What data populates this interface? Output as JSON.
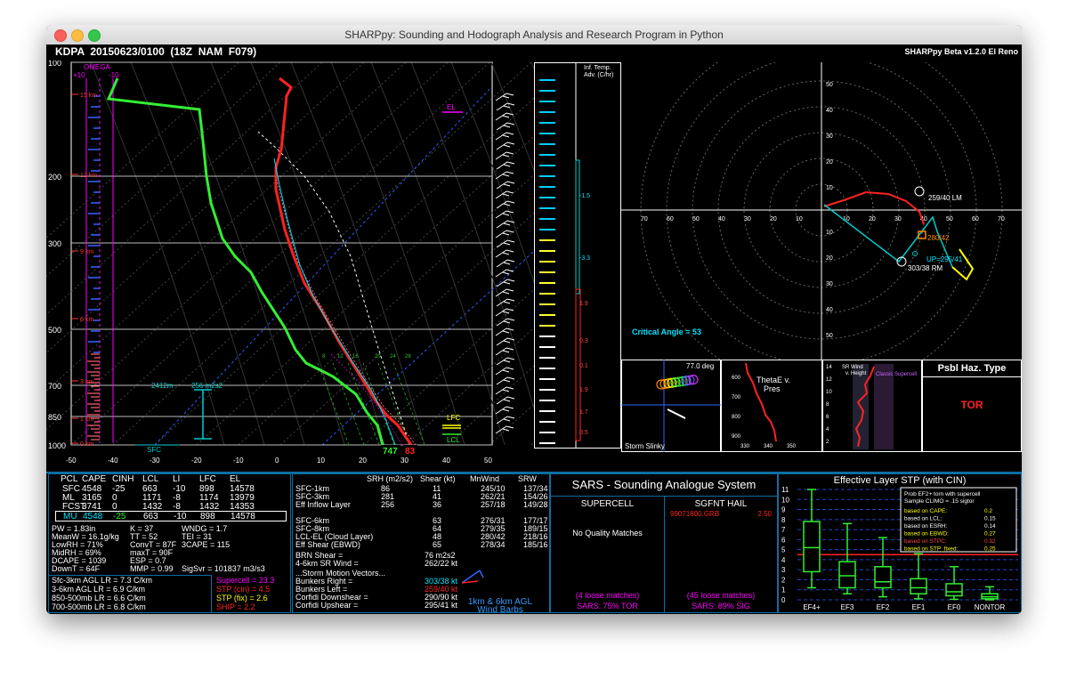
{
  "window": {
    "title": "SHARPpy: Sounding and Hodograph Analysis and Research Program in Python",
    "station_label": "KDPA  20150623/0100  (18Z  NAM  F079)",
    "version_label": "SHARPpy Beta v1.2.0 El Reno"
  },
  "skewt": {
    "pressure_levels": [
      "100",
      "200",
      "300",
      "500",
      "700",
      "850",
      "1000"
    ],
    "temp_ticks": [
      "-50",
      "-40",
      "-30",
      "-20",
      "-10",
      "0",
      "10",
      "20",
      "30",
      "40",
      "50"
    ],
    "height_marks": [
      "15 km",
      "12 km",
      "9 km",
      "6 km",
      "3 km",
      "1 km",
      "0 km"
    ],
    "omega_label": "OMEGA",
    "omega_ticks": [
      "+10",
      "-10"
    ],
    "el_label": "EL",
    "lfc_label": "LFC",
    "lcl_label": "LCL",
    "sfc_label": "SFC",
    "inflow_top": "2412m",
    "inflow_srh": "256 m2s2",
    "surface_temp": "747",
    "surface_dew": "83",
    "mixing_ratio_ticks": [
      "8",
      "12",
      "16",
      "20",
      "24",
      "28"
    ]
  },
  "inferred_temp_adv": {
    "title": "Inf. Temp. Adv. (C/hr)",
    "values": [
      "-1.5",
      "-3.3",
      "1.9",
      "0.3",
      "0.1",
      "1.9",
      "1.7",
      "0.5"
    ]
  },
  "hodograph": {
    "rings": [
      "10",
      "20",
      "30",
      "40",
      "50"
    ],
    "x_ticks": [
      "70",
      "60",
      "50",
      "40",
      "30",
      "20",
      "10",
      "10",
      "20",
      "30",
      "40",
      "50",
      "60",
      "70"
    ],
    "lm_label": "259/40 LM",
    "rm_label": "303/38 RM",
    "mean_label": "280/42",
    "up_label": "UP=295/41",
    "critical_angle": "Critical Angle = 53"
  },
  "storm_slinky": {
    "title": "Storm Slinky",
    "angle": "77.0 deg"
  },
  "thetae": {
    "title_line1": "ThetaE v.",
    "title_line2": "Pres",
    "y_ticks": [
      "600",
      "700",
      "800",
      "900"
    ],
    "x_ticks": [
      "330",
      "340",
      "350"
    ]
  },
  "srwind": {
    "title_line1": "SR Wind",
    "title_line2": "v. Height",
    "supercell_label": "Classic Supercell",
    "y_ticks": [
      "14",
      "12",
      "10",
      "8",
      "6",
      "4",
      "2"
    ]
  },
  "hazard": {
    "title": "Psbl Haz. Type",
    "value": "TOR"
  },
  "parcel_table": {
    "headers": [
      "PCL",
      "CAPE",
      "CINH",
      "LCL",
      "LI",
      "LFC",
      "EL"
    ],
    "rows": [
      [
        "SFC",
        "4548",
        "-25",
        "663",
        "-10",
        "898",
        "14578"
      ],
      [
        "ML",
        "3165",
        "0",
        "1171",
        "-8",
        "1174",
        "13979"
      ],
      [
        "FCST",
        "3741",
        "0",
        "1432",
        "-8",
        "1432",
        "14353"
      ],
      [
        "MU",
        "4548",
        "-25",
        "663",
        "-10",
        "898",
        "14578"
      ]
    ]
  },
  "indices": {
    "col1": [
      "PW = 1.83in",
      "MeanW = 16.1g/kg",
      "LowRH = 71%",
      "MidRH = 69%",
      "DCAPE = 1039",
      "DownT = 64F"
    ],
    "col2": [
      "K = 37",
      "TT = 52",
      "ConvT = 87F",
      "maxT = 90F",
      "ESP = 0.7",
      "MMP = 0.99"
    ],
    "col3": [
      "WNDG = 1.7",
      "TEI = 31",
      "3CAPE = 115",
      "",
      "",
      "SigSvr = 101837 m3/s3"
    ]
  },
  "lapse_rates": [
    "Sfc-3km AGL LR = 7.3 C/km",
    "3-6km AGL LR = 6.9 C/km",
    "850-500mb LR = 6.6 C/km",
    "700-500mb LR = 6.8 C/km"
  ],
  "composite": [
    "Supercell = 23.3",
    "STP (cin) = 4.5",
    "STP (fix) = 2.6",
    "SHIP = 2.2"
  ],
  "kinematics": {
    "headers": [
      "SRH (m2/s2)",
      "Shear (kt)",
      "MnWind",
      "SRW"
    ],
    "rows": [
      [
        "SFC-1km",
        "86",
        "11",
        "245/10",
        "137/34"
      ],
      [
        "SFC-3km",
        "281",
        "41",
        "262/21",
        "154/26"
      ],
      [
        "Eff Inflow Layer",
        "256",
        "36",
        "257/18",
        "149/28"
      ],
      [
        "",
        "",
        "",
        "",
        ""
      ],
      [
        "SFC-6km",
        "",
        "63",
        "276/31",
        "177/17"
      ],
      [
        "SFC-8km",
        "",
        "64",
        "279/35",
        "189/15"
      ],
      [
        "LCL-EL (Cloud Layer)",
        "",
        "48",
        "280/42",
        "218/16"
      ],
      [
        "Eff Shear (EBWD)",
        "",
        "65",
        "278/34",
        "185/16"
      ]
    ],
    "brn_shear": [
      "BRN Shear =",
      "76 m2s2"
    ],
    "sr_wind_46": [
      "4-6km SR Wind =",
      "262/22 kt"
    ],
    "storm_motion_title": "...Storm Motion Vectors...",
    "motions": [
      [
        "Bunkers Right =",
        "303/38 kt"
      ],
      [
        "Bunkers Left =",
        "259/40 kt"
      ],
      [
        "Corfidi Downshear =",
        "290/90 kt"
      ],
      [
        "Corfidi Upshear =",
        "295/41 kt"
      ]
    ],
    "barb_caption_1": "1km & 6km AGL",
    "barb_caption_2": "Wind Barbs"
  },
  "sars": {
    "title": "SARS - Sounding Analogue System",
    "supercell_title": "SUPERCELL",
    "hail_title": "SGFNT HAIL",
    "hail_match": "99071800.GRB",
    "hail_size": "2.50",
    "no_matches": "No Quality Matches",
    "supercell_loose": "(4 loose matches)",
    "supercell_result": "SARS: 75% TOR",
    "hail_loose": "(45 loose matches)",
    "hail_result": "SARS: 89% SIG"
  },
  "stp": {
    "title": "Effective Layer STP (with CIN)",
    "y_ticks": [
      "11",
      "10",
      "9",
      "8",
      "7",
      "6",
      "5",
      "4",
      "3",
      "2",
      "1",
      "0"
    ],
    "categories": [
      "EF4+",
      "EF3",
      "EF2",
      "EF1",
      "EF0",
      "NONTOR"
    ],
    "legend_title_1": "Prob EF2+ torn with supercell",
    "legend_title_2": "Sample CLIMO = .15 sigtor",
    "legend_rows": [
      [
        "based on CAPE:",
        "0.2"
      ],
      [
        "based on LCL:",
        "0.15"
      ],
      [
        "based on ESRH:",
        "0.14"
      ],
      [
        "based on EBWD:",
        "0.27"
      ],
      [
        "based on STPC:",
        "0.32"
      ],
      [
        "based on STP_fixed:",
        "0.25"
      ]
    ],
    "current_value": 4.5
  }
}
